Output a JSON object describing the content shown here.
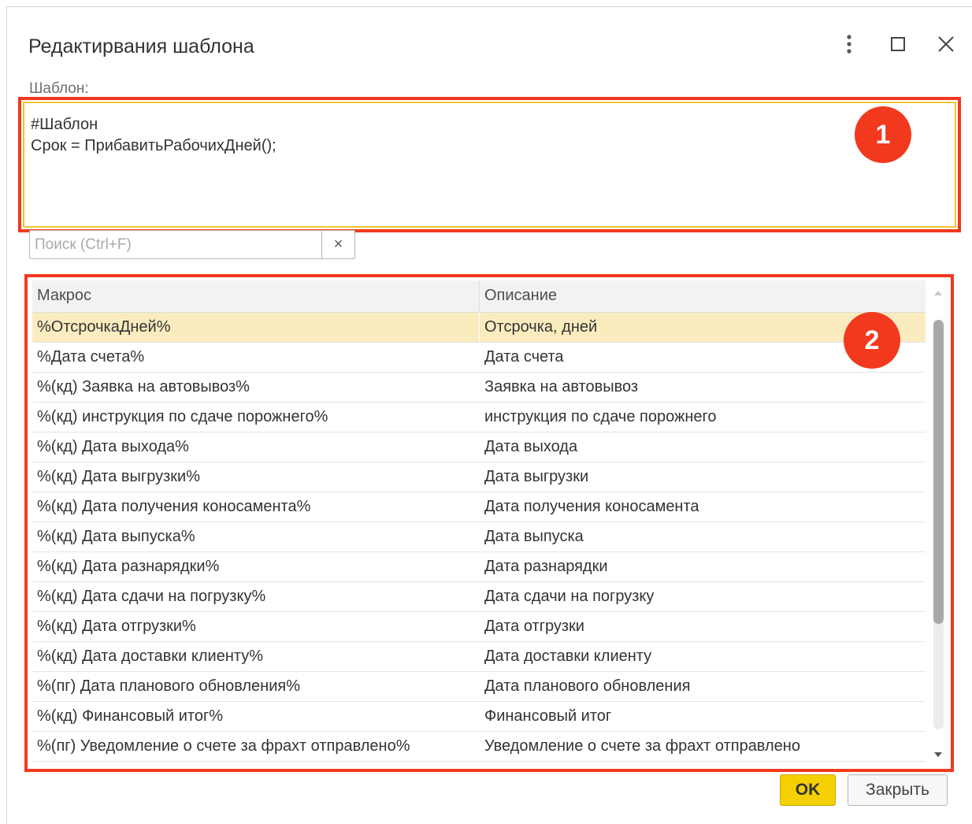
{
  "window": {
    "title": "Редактирвания шаблона",
    "buttons": [
      "more-options",
      "maximize",
      "close"
    ]
  },
  "template_field": {
    "label": "Шаблон:",
    "value": "#Шаблон\nСрок = ПрибавитьРабочихДней();",
    "highlight_color": "#f4c430"
  },
  "annotations": {
    "badge_1": "1",
    "badge_2": "2",
    "color": "#f2391d"
  },
  "search": {
    "placeholder": "Поиск (Ctrl+F)",
    "value": "",
    "clear_label": "×"
  },
  "table": {
    "columns": [
      "Макрос",
      "Описание"
    ],
    "selected_index": 0,
    "rows": [
      {
        "macro": "%ОтсрочкаДней%",
        "description": "Отсрочка, дней"
      },
      {
        "macro": "%Дата счета%",
        "description": "Дата счета"
      },
      {
        "macro": "%(кд) Заявка на автовывоз%",
        "description": "Заявка на автовывоз"
      },
      {
        "macro": "%(кд) инструкция по сдаче порожнего%",
        "description": "инструкция по сдаче порожнего"
      },
      {
        "macro": "%(кд) Дата выхода%",
        "description": "Дата выхода"
      },
      {
        "macro": "%(кд) Дата выгрузки%",
        "description": "Дата выгрузки"
      },
      {
        "macro": "%(кд) Дата получения коносамента%",
        "description": "Дата получения коносамента"
      },
      {
        "macro": "%(кд) Дата выпуска%",
        "description": "Дата выпуска"
      },
      {
        "macro": "%(кд) Дата разнарядки%",
        "description": "Дата разнарядки"
      },
      {
        "macro": "%(кд) Дата сдачи на погрузку%",
        "description": "Дата сдачи на погрузку"
      },
      {
        "macro": "%(кд) Дата отгрузки%",
        "description": "Дата отгрузки"
      },
      {
        "macro": "%(кд) Дата доставки клиенту%",
        "description": "Дата доставки клиенту"
      },
      {
        "macro": "%(пг) Дата планового обновления%",
        "description": "Дата планового обновления"
      },
      {
        "macro": "%(кд) Финансовый итог%",
        "description": "Финансовый итог"
      },
      {
        "macro": "%(пг) Уведомление о счете за фрахт отправлено%",
        "description": "Уведомление о счете за фрахт отправлено"
      }
    ]
  },
  "footer": {
    "ok_label": "OK",
    "close_label": "Закрыть"
  }
}
